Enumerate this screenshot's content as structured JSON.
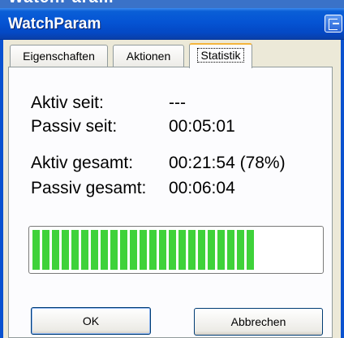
{
  "window": {
    "title": "WatchParam",
    "top_strip_text": "WatchParam"
  },
  "tabs": [
    {
      "label": "Eigenschaften",
      "selected": false
    },
    {
      "label": "Aktionen",
      "selected": false
    },
    {
      "label": "Statistik",
      "selected": true
    }
  ],
  "stats": {
    "aktiv_seit": {
      "label": "Aktiv seit:",
      "value": "---"
    },
    "passiv_seit": {
      "label": "Passiv seit:",
      "value": "00:05:01"
    },
    "aktiv_gesamt": {
      "label": "Aktiv gesamt:",
      "value": "00:21:54 (78%)"
    },
    "passiv_gesamt": {
      "label": "Passiv gesamt:",
      "value": "00:06:04"
    }
  },
  "progress": {
    "percent": 78,
    "color": "#3fd23a"
  },
  "buttons": {
    "ok": "OK",
    "cancel": "Abbrechen"
  },
  "icons": {
    "system_menu": "window-menu-icon"
  }
}
